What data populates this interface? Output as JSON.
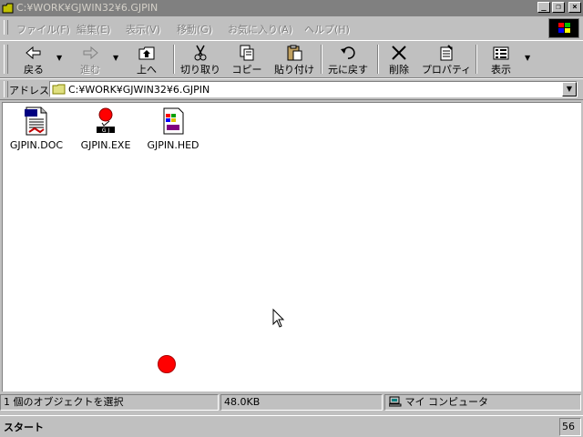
{
  "window": {
    "title": "C:¥WORK¥GJWIN32¥6.GJPIN",
    "caption_buttons": [
      "minimize",
      "restore",
      "close"
    ]
  },
  "menu": [
    {
      "label": "ファイル(F)"
    },
    {
      "label": "編集(E)"
    },
    {
      "label": "表示(V)"
    },
    {
      "label": "移動(G)"
    },
    {
      "label": "お気に入り(A)"
    },
    {
      "label": "ヘルプ(H)"
    }
  ],
  "toolbar": {
    "back": "戻る",
    "forward": "進む",
    "up": "上へ",
    "cut": "切り取り",
    "copy": "コピー",
    "paste": "貼り付け",
    "undo": "元に戻す",
    "delete": "削除",
    "properties": "プロパティ",
    "views": "表示"
  },
  "address": {
    "label": "アドレス",
    "path": "C:¥WORK¥GJWIN32¥6.GJPIN"
  },
  "files": [
    {
      "name": "GJPIN.DOC",
      "icon": "document-icon"
    },
    {
      "name": "GJPIN.EXE",
      "icon": "exe-red-dot-icon"
    },
    {
      "name": "GJPIN.HED",
      "icon": "help-file-icon"
    }
  ],
  "status": {
    "selection": "1 個のオブジェクトを選択",
    "size": "48.0KB",
    "location": "マイ コンピュータ"
  },
  "taskbar": {
    "start": "スタート",
    "tray": "56"
  },
  "colors": {
    "desktop_gray": "#c0c0c0",
    "title_inactive": "#808080",
    "content_bg": "#ffffff",
    "red_dot": "#ff0000"
  }
}
